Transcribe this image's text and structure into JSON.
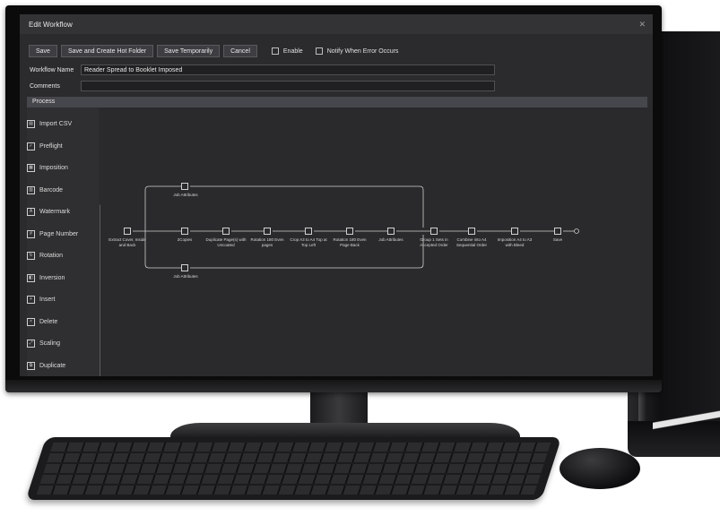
{
  "dialog": {
    "title": "Edit Workflow",
    "close_icon": "close-icon"
  },
  "toolbar": {
    "save": "Save",
    "save_hot_folder": "Save and Create Hot Folder",
    "save_temp": "Save Temporarily",
    "cancel": "Cancel",
    "enable": "Enable",
    "notify": "Notify When Error Occurs"
  },
  "fields": {
    "workflow_name_label": "Workflow Name",
    "workflow_name_value": "Reader Spread to Booklet Imposed",
    "comments_label": "Comments",
    "comments_value": ""
  },
  "process": {
    "label": "Process"
  },
  "sidebar": {
    "items": [
      {
        "label": "Import CSV",
        "icon": "printer-icon"
      },
      {
        "label": "Preflight",
        "icon": "preflight-icon"
      },
      {
        "label": "Imposition",
        "icon": "imposition-icon"
      },
      {
        "label": "Barcode",
        "icon": "barcode-icon"
      },
      {
        "label": "Watermark",
        "icon": "watermark-icon"
      },
      {
        "label": "Page Number",
        "icon": "page-number-icon"
      },
      {
        "label": "Rotation",
        "icon": "rotation-icon"
      },
      {
        "label": "Inversion",
        "icon": "inversion-icon"
      },
      {
        "label": "Insert",
        "icon": "insert-icon"
      },
      {
        "label": "Delete",
        "icon": "delete-icon"
      },
      {
        "label": "Scaling",
        "icon": "scaling-icon"
      },
      {
        "label": "Duplicate",
        "icon": "duplicate-icon"
      }
    ]
  },
  "workflow": {
    "nodes": [
      {
        "label": "Extract Cover, Inside and Back"
      },
      {
        "label": "2Copies"
      },
      {
        "label": "Duplicate Page(s) with Uncoated"
      },
      {
        "label": "Rotation 180 Even pages"
      },
      {
        "label": "Crop A3 to A4 Top at Top Left"
      },
      {
        "label": "Rotation 180 Even Page Back"
      },
      {
        "label": "Job Attributes"
      },
      {
        "label": "Group 1 Sets in Accepted Order"
      },
      {
        "label": "Combine into A4 Sequential Order"
      },
      {
        "label": "Imposition A4 to A3 with Bleed"
      },
      {
        "label": "Save"
      }
    ],
    "branch_top": "Job Attributes",
    "branch_bottom": "Job Attributes"
  }
}
